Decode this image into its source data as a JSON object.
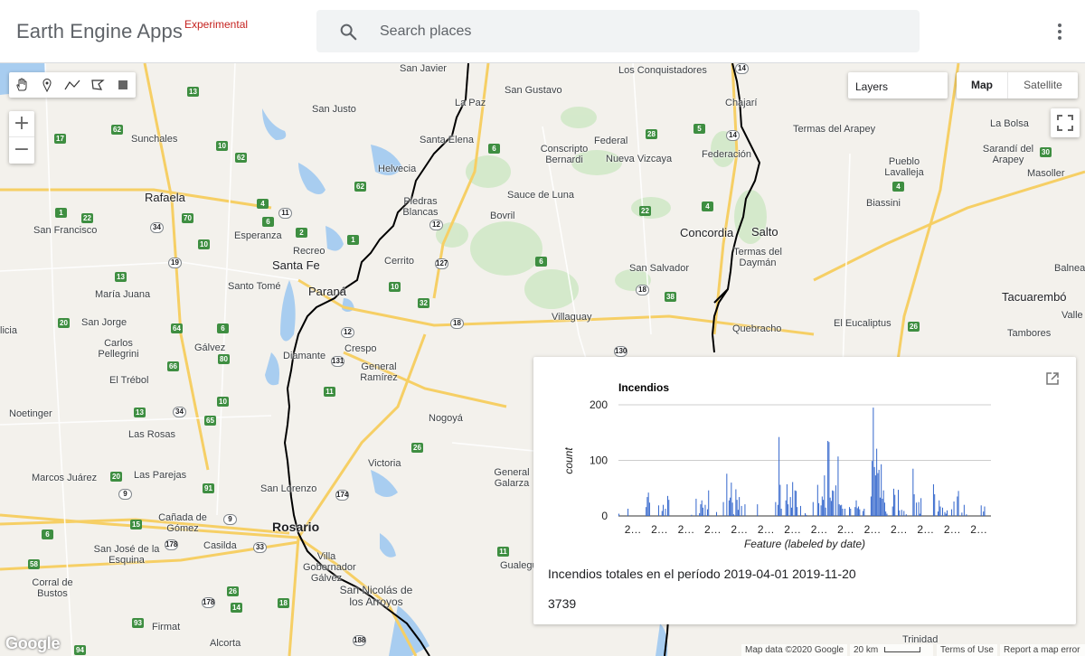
{
  "header": {
    "title": "Earth Engine Apps",
    "badge": "Experimental",
    "search_placeholder": "Search places",
    "search_icon": "search-icon",
    "menu_icon": "more-vert-icon"
  },
  "map": {
    "controls": {
      "draw_tools": [
        "hand-icon",
        "marker-icon",
        "polyline-icon",
        "polygon-icon",
        "rectangle-icon"
      ],
      "zoom_in": "+",
      "zoom_out": "−",
      "layers_label": "Layers",
      "map_type": [
        "Map",
        "Satellite"
      ],
      "fullscreen_icon": "fullscreen-icon"
    },
    "places": [
      {
        "name": "San Javier"
      },
      {
        "name": "San Gustavo"
      },
      {
        "name": "Los Conquistadores"
      },
      {
        "name": "Chajarí"
      },
      {
        "name": "San Justo"
      },
      {
        "name": "La Paz"
      },
      {
        "name": "Termas del Arapey"
      },
      {
        "name": "La Bolsa"
      },
      {
        "name": "Sunchales"
      },
      {
        "name": "Santa Elena"
      },
      {
        "name": "Federal"
      },
      {
        "name": "Conscripto Bernardi"
      },
      {
        "name": "Nueva Vizcaya"
      },
      {
        "name": "Federación"
      },
      {
        "name": "Sarandí del Arapey"
      },
      {
        "name": "Rafaela"
      },
      {
        "name": "Helvecia"
      },
      {
        "name": "Pueblo Lavalleja"
      },
      {
        "name": "Masoller"
      },
      {
        "name": "Piedras Blancas"
      },
      {
        "name": "Sauce de Luna"
      },
      {
        "name": "Biassini"
      },
      {
        "name": "San Francisco"
      },
      {
        "name": "Esperanza"
      },
      {
        "name": "Bovril"
      },
      {
        "name": "Concordia"
      },
      {
        "name": "Salto"
      },
      {
        "name": "Recreo"
      },
      {
        "name": "Termas del Daymán"
      },
      {
        "name": "Santa Fe"
      },
      {
        "name": "Cerrito"
      },
      {
        "name": "San Salvador"
      },
      {
        "name": "Balnea"
      },
      {
        "name": "María Juana"
      },
      {
        "name": "Santo Tomé"
      },
      {
        "name": "Paraná"
      },
      {
        "name": "Tacuarembó"
      },
      {
        "name": "San Jorge"
      },
      {
        "name": "Villaguay"
      },
      {
        "name": "Valle Edén"
      },
      {
        "name": "El Eucaliptus"
      },
      {
        "name": "Carlos Pellegrini"
      },
      {
        "name": "Gálvez"
      },
      {
        "name": "Crespo"
      },
      {
        "name": "Quebracho"
      },
      {
        "name": "Tambores"
      },
      {
        "name": "Diamante"
      },
      {
        "name": "General Ramírez"
      },
      {
        "name": "El Trébol"
      },
      {
        "name": "Noetinger"
      },
      {
        "name": "Nogoyá"
      },
      {
        "name": "Las Rosas"
      },
      {
        "name": "Victoria"
      },
      {
        "name": "Marcos Juárez"
      },
      {
        "name": "Las Parejas"
      },
      {
        "name": "San Lorenzo"
      },
      {
        "name": "General Galarza"
      },
      {
        "name": "Cañada de Gómez"
      },
      {
        "name": "Rosario"
      },
      {
        "name": "San José de la Esquina"
      },
      {
        "name": "Casilda"
      },
      {
        "name": "Villa Gobernador Gálvez"
      },
      {
        "name": "Gualeguay"
      },
      {
        "name": "Corral de Bustos"
      },
      {
        "name": "San Nicolás de los Arroyos"
      },
      {
        "name": "Firmat"
      },
      {
        "name": "Alcorta"
      },
      {
        "name": "Trinidad"
      },
      {
        "name": "licia"
      }
    ],
    "attribution": {
      "logo": "Google",
      "map_data": "Map data ©2020 Google",
      "scale": "20 km",
      "terms": "Terms of Use",
      "report": "Report a map error"
    }
  },
  "panel": {
    "popout_icon": "open-in-new-icon",
    "total_label": "Incendios totales en el período 2019-04-01 2019-11-20",
    "total_value": "3739"
  },
  "chart_data": {
    "type": "bar",
    "title": "Incendios",
    "xlabel": "Feature (labeled by date)",
    "ylabel": "count",
    "ylim": [
      0,
      200
    ],
    "yticks": [
      0,
      100,
      200
    ],
    "grid": true,
    "legend": "none",
    "color": "#3366cc",
    "x_tick_label": "2…",
    "x_tick_count": 14,
    "values": [
      4,
      0,
      0,
      0,
      0,
      0,
      0,
      0,
      13,
      0,
      0,
      0,
      0,
      0,
      0,
      0,
      0,
      0,
      0,
      0,
      0,
      0,
      0,
      0,
      16,
      34,
      42,
      24,
      0,
      0,
      0,
      0,
      0,
      0,
      0,
      19,
      0,
      0,
      9,
      20,
      0,
      13,
      0,
      36,
      29,
      0,
      0,
      0,
      0,
      0,
      0,
      0,
      0,
      0,
      0,
      0,
      0,
      0,
      0,
      0,
      0,
      0,
      0,
      0,
      2,
      0,
      0,
      0,
      31,
      0,
      0,
      5,
      21,
      28,
      15,
      0,
      20,
      0,
      12,
      46,
      0,
      0,
      0,
      0,
      0,
      0,
      7,
      0,
      0,
      0,
      0,
      0,
      25,
      0,
      0,
      76,
      0,
      28,
      33,
      60,
      24,
      3,
      0,
      48,
      29,
      11,
      34,
      0,
      18,
      0,
      0,
      21,
      0,
      0,
      0,
      0,
      0,
      0,
      0,
      0,
      0,
      0,
      21,
      0,
      0,
      0,
      0,
      0,
      0,
      0,
      0,
      0,
      0,
      0,
      0,
      0,
      0,
      0,
      25,
      0,
      20,
      142,
      56,
      13,
      0,
      0,
      0,
      28,
      57,
      21,
      0,
      34,
      15,
      61,
      0,
      46,
      45,
      16,
      0,
      0,
      18,
      0,
      0,
      0,
      5,
      2,
      0,
      0,
      0,
      0,
      0,
      25,
      0,
      0,
      0,
      56,
      23,
      0,
      19,
      35,
      29,
      73,
      15,
      0,
      135,
      133,
      33,
      27,
      46,
      45,
      0,
      55,
      0,
      107,
      21,
      19,
      20,
      13,
      0,
      13,
      0,
      0,
      0,
      16,
      13,
      0,
      0,
      0,
      16,
      28,
      14,
      17,
      12,
      0,
      0,
      9,
      13,
      0,
      0,
      0,
      0,
      0,
      35,
      99,
      195,
      88,
      73,
      121,
      77,
      83,
      33,
      93,
      31,
      46,
      24,
      8,
      4,
      0,
      0,
      0,
      0,
      17,
      49,
      38,
      0,
      0,
      47,
      10,
      0,
      11,
      0,
      9,
      0,
      3,
      0,
      0,
      0,
      0,
      0,
      85,
      39,
      0,
      24,
      0,
      25,
      4,
      32,
      0,
      0,
      0,
      0,
      0,
      0,
      0,
      0,
      0,
      0,
      57,
      39,
      0,
      0,
      8,
      28,
      17,
      0,
      15,
      0,
      7,
      4,
      10,
      0,
      0,
      0,
      12,
      0,
      26,
      0,
      0,
      35,
      45,
      0,
      0,
      6,
      0,
      20,
      0,
      3,
      0,
      0,
      0,
      0,
      0,
      0,
      0,
      0,
      0,
      0,
      0,
      0,
      19,
      0,
      8,
      17,
      0,
      0,
      0,
      0,
      0
    ]
  }
}
